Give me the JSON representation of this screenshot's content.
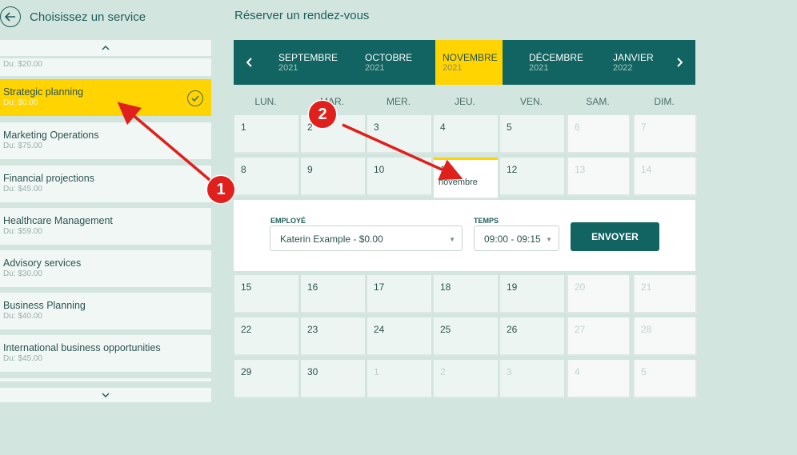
{
  "left": {
    "title": "Choisissez un service",
    "partial_price": "Du: $20.00",
    "services": [
      {
        "name": "Strategic planning",
        "price": "Du: $0.00",
        "selected": true
      },
      {
        "name": "Marketing Operations",
        "price": "Du: $75.00"
      },
      {
        "name": "Financial projections",
        "price": "Du: $45.00"
      },
      {
        "name": "Healthcare Management",
        "price": "Du: $59.00"
      },
      {
        "name": "Advisory services",
        "price": "Du: $30.00"
      },
      {
        "name": "Business Planning",
        "price": "Du: $40.00"
      },
      {
        "name": "International business opportunities",
        "price": "Du: $45.00"
      }
    ]
  },
  "right": {
    "title": "Réserver un rendez-vous",
    "months": [
      {
        "name": "SEPTEMBRE",
        "year": "2021"
      },
      {
        "name": "OCTOBRE",
        "year": "2021"
      },
      {
        "name": "NOVEMBRE",
        "year": "2021",
        "active": true
      },
      {
        "name": "DÉCEMBRE",
        "year": "2021"
      },
      {
        "name": "JANVIER",
        "year": "2022"
      }
    ],
    "weekdays": [
      "LUN.",
      "MAR.",
      "MER.",
      "JEU.",
      "VEN.",
      "SAM.",
      "DIM."
    ],
    "week1": [
      "1",
      "2",
      "3",
      "4",
      "5",
      "6",
      "7"
    ],
    "week2": [
      "8",
      "9",
      "10",
      "11",
      "12",
      "13",
      "14"
    ],
    "week3": [
      "15",
      "16",
      "17",
      "18",
      "19",
      "20",
      "21"
    ],
    "week4": [
      "22",
      "23",
      "24",
      "25",
      "26",
      "27",
      "28"
    ],
    "week5": [
      "29",
      "30",
      "1",
      "2",
      "3",
      "4",
      "5"
    ],
    "selected_month_label": "novembre",
    "booking": {
      "employee_label": "EMPLOYÉ",
      "employee_value": "Katerin Example - $0.00",
      "time_label": "TEMPS",
      "time_value": "09:00 - 09:15",
      "submit_label": "ENVOYER"
    }
  },
  "annotations": {
    "badge1": "1",
    "badge2": "2",
    "arrow_color": "#e0201c"
  },
  "colors": {
    "accent": "#ffd400",
    "primary": "#116462",
    "background": "#d3e5df"
  }
}
